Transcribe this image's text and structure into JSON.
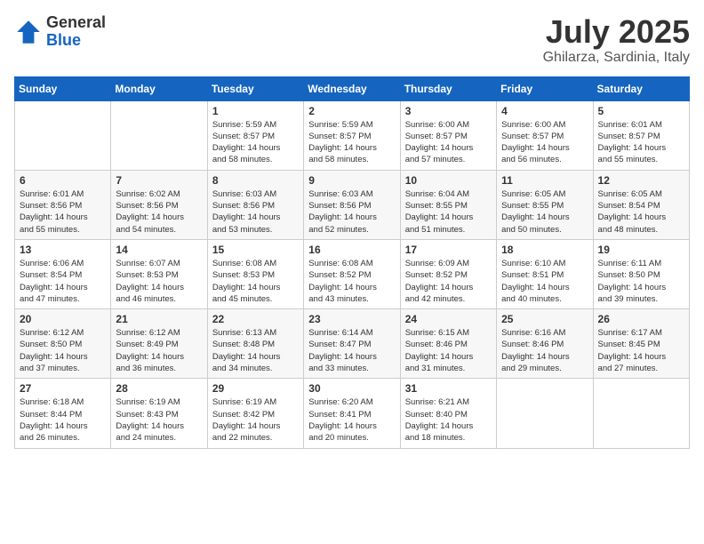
{
  "header": {
    "logo_general": "General",
    "logo_blue": "Blue",
    "title": "July 2025",
    "subtitle": "Ghilarza, Sardinia, Italy"
  },
  "calendar": {
    "days_of_week": [
      "Sunday",
      "Monday",
      "Tuesday",
      "Wednesday",
      "Thursday",
      "Friday",
      "Saturday"
    ],
    "weeks": [
      [
        {
          "day": "",
          "info": ""
        },
        {
          "day": "",
          "info": ""
        },
        {
          "day": "1",
          "info": "Sunrise: 5:59 AM\nSunset: 8:57 PM\nDaylight: 14 hours\nand 58 minutes."
        },
        {
          "day": "2",
          "info": "Sunrise: 5:59 AM\nSunset: 8:57 PM\nDaylight: 14 hours\nand 58 minutes."
        },
        {
          "day": "3",
          "info": "Sunrise: 6:00 AM\nSunset: 8:57 PM\nDaylight: 14 hours\nand 57 minutes."
        },
        {
          "day": "4",
          "info": "Sunrise: 6:00 AM\nSunset: 8:57 PM\nDaylight: 14 hours\nand 56 minutes."
        },
        {
          "day": "5",
          "info": "Sunrise: 6:01 AM\nSunset: 8:57 PM\nDaylight: 14 hours\nand 55 minutes."
        }
      ],
      [
        {
          "day": "6",
          "info": "Sunrise: 6:01 AM\nSunset: 8:56 PM\nDaylight: 14 hours\nand 55 minutes."
        },
        {
          "day": "7",
          "info": "Sunrise: 6:02 AM\nSunset: 8:56 PM\nDaylight: 14 hours\nand 54 minutes."
        },
        {
          "day": "8",
          "info": "Sunrise: 6:03 AM\nSunset: 8:56 PM\nDaylight: 14 hours\nand 53 minutes."
        },
        {
          "day": "9",
          "info": "Sunrise: 6:03 AM\nSunset: 8:56 PM\nDaylight: 14 hours\nand 52 minutes."
        },
        {
          "day": "10",
          "info": "Sunrise: 6:04 AM\nSunset: 8:55 PM\nDaylight: 14 hours\nand 51 minutes."
        },
        {
          "day": "11",
          "info": "Sunrise: 6:05 AM\nSunset: 8:55 PM\nDaylight: 14 hours\nand 50 minutes."
        },
        {
          "day": "12",
          "info": "Sunrise: 6:05 AM\nSunset: 8:54 PM\nDaylight: 14 hours\nand 48 minutes."
        }
      ],
      [
        {
          "day": "13",
          "info": "Sunrise: 6:06 AM\nSunset: 8:54 PM\nDaylight: 14 hours\nand 47 minutes."
        },
        {
          "day": "14",
          "info": "Sunrise: 6:07 AM\nSunset: 8:53 PM\nDaylight: 14 hours\nand 46 minutes."
        },
        {
          "day": "15",
          "info": "Sunrise: 6:08 AM\nSunset: 8:53 PM\nDaylight: 14 hours\nand 45 minutes."
        },
        {
          "day": "16",
          "info": "Sunrise: 6:08 AM\nSunset: 8:52 PM\nDaylight: 14 hours\nand 43 minutes."
        },
        {
          "day": "17",
          "info": "Sunrise: 6:09 AM\nSunset: 8:52 PM\nDaylight: 14 hours\nand 42 minutes."
        },
        {
          "day": "18",
          "info": "Sunrise: 6:10 AM\nSunset: 8:51 PM\nDaylight: 14 hours\nand 40 minutes."
        },
        {
          "day": "19",
          "info": "Sunrise: 6:11 AM\nSunset: 8:50 PM\nDaylight: 14 hours\nand 39 minutes."
        }
      ],
      [
        {
          "day": "20",
          "info": "Sunrise: 6:12 AM\nSunset: 8:50 PM\nDaylight: 14 hours\nand 37 minutes."
        },
        {
          "day": "21",
          "info": "Sunrise: 6:12 AM\nSunset: 8:49 PM\nDaylight: 14 hours\nand 36 minutes."
        },
        {
          "day": "22",
          "info": "Sunrise: 6:13 AM\nSunset: 8:48 PM\nDaylight: 14 hours\nand 34 minutes."
        },
        {
          "day": "23",
          "info": "Sunrise: 6:14 AM\nSunset: 8:47 PM\nDaylight: 14 hours\nand 33 minutes."
        },
        {
          "day": "24",
          "info": "Sunrise: 6:15 AM\nSunset: 8:46 PM\nDaylight: 14 hours\nand 31 minutes."
        },
        {
          "day": "25",
          "info": "Sunrise: 6:16 AM\nSunset: 8:46 PM\nDaylight: 14 hours\nand 29 minutes."
        },
        {
          "day": "26",
          "info": "Sunrise: 6:17 AM\nSunset: 8:45 PM\nDaylight: 14 hours\nand 27 minutes."
        }
      ],
      [
        {
          "day": "27",
          "info": "Sunrise: 6:18 AM\nSunset: 8:44 PM\nDaylight: 14 hours\nand 26 minutes."
        },
        {
          "day": "28",
          "info": "Sunrise: 6:19 AM\nSunset: 8:43 PM\nDaylight: 14 hours\nand 24 minutes."
        },
        {
          "day": "29",
          "info": "Sunrise: 6:19 AM\nSunset: 8:42 PM\nDaylight: 14 hours\nand 22 minutes."
        },
        {
          "day": "30",
          "info": "Sunrise: 6:20 AM\nSunset: 8:41 PM\nDaylight: 14 hours\nand 20 minutes."
        },
        {
          "day": "31",
          "info": "Sunrise: 6:21 AM\nSunset: 8:40 PM\nDaylight: 14 hours\nand 18 minutes."
        },
        {
          "day": "",
          "info": ""
        },
        {
          "day": "",
          "info": ""
        }
      ]
    ]
  }
}
